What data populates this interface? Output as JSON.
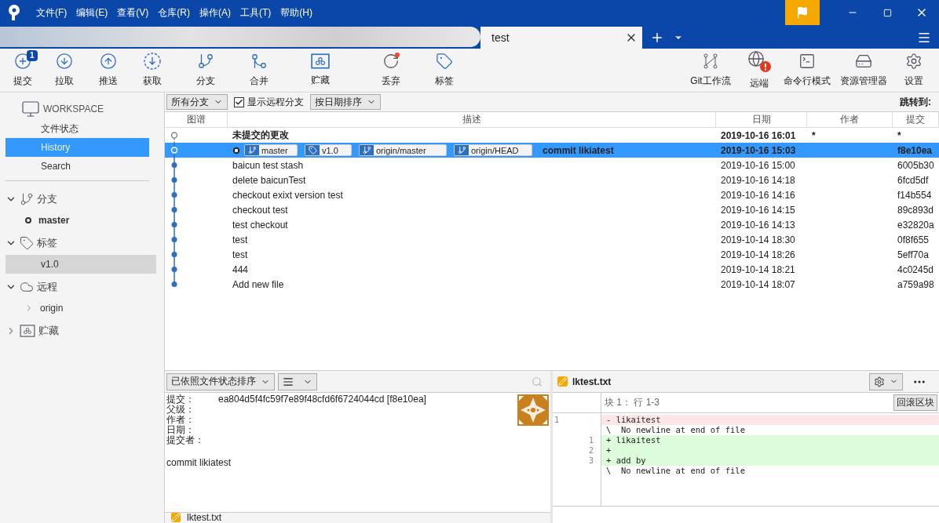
{
  "menu": [
    "文件(F)",
    "编辑(E)",
    "查看(V)",
    "仓库(R)",
    "操作(A)",
    "工具(T)",
    "帮助(H)"
  ],
  "tab": {
    "title": "test",
    "selected": true
  },
  "toolbar_left": [
    {
      "kind": "commit",
      "label": "提交",
      "badge": "1"
    },
    {
      "kind": "pull",
      "label": "拉取"
    },
    {
      "kind": "push",
      "label": "推送"
    },
    {
      "kind": "fetch",
      "label": "获取"
    },
    {
      "kind": "branch",
      "label": "分支"
    },
    {
      "kind": "merge",
      "label": "合并"
    },
    {
      "kind": "stash",
      "label": "贮藏"
    },
    {
      "kind": "discard",
      "label": "丢弃"
    },
    {
      "kind": "tag",
      "label": "标签"
    }
  ],
  "toolbar_right": [
    {
      "kind": "gitflow",
      "label": "Git工作流"
    },
    {
      "kind": "remote",
      "label": "远端"
    },
    {
      "kind": "terminal",
      "label": "命令行模式"
    },
    {
      "kind": "explorer",
      "label": "资源管理器"
    },
    {
      "kind": "settings",
      "label": "设置"
    }
  ],
  "sidebar": {
    "workspace": {
      "title": "WORKSPACE",
      "items": [
        {
          "label": "文件状态",
          "selected": false
        },
        {
          "label": "History",
          "selected": true
        },
        {
          "label": "Search",
          "selected": false
        }
      ]
    },
    "sections": [
      {
        "kind": "branch",
        "title": "分支",
        "expanded": true,
        "children": [
          {
            "label": "master",
            "current": true,
            "selected": false
          }
        ]
      },
      {
        "kind": "tag",
        "title": "标签",
        "expanded": true,
        "children": [
          {
            "label": "v1.0",
            "current": false,
            "selected": true
          }
        ]
      },
      {
        "kind": "remote",
        "title": "远程",
        "expanded": true,
        "children": [
          {
            "label": "origin",
            "current": false,
            "selected": false,
            "expanded": false
          }
        ]
      },
      {
        "kind": "stash",
        "title": "贮藏",
        "expanded": false
      }
    ]
  },
  "filter": {
    "branches": "所有分支",
    "show_remote": {
      "label": "显示远程分支",
      "checked": true
    },
    "sort": "按日期排序",
    "jump": "跳转到:"
  },
  "table": {
    "columns": [
      "图谱",
      "描述",
      "日期",
      "作者",
      "提交"
    ],
    "rows": [
      {
        "kind": "uncommitted",
        "selected": false,
        "description": "未提交的更改",
        "date": "2019-10-16 16:01",
        "author": "*",
        "commit": "*"
      },
      {
        "kind": "commit",
        "selected": true,
        "head": true,
        "refs": [
          {
            "kind": "branch",
            "label": "master"
          },
          {
            "kind": "tag",
            "label": "v1.0"
          },
          {
            "kind": "branch",
            "label": "origin/master"
          },
          {
            "kind": "branch",
            "label": "origin/HEAD"
          }
        ],
        "description": "commit likiatest",
        "date": "2019-10-16 15:03",
        "commit": "f8e10ea"
      },
      {
        "kind": "commit",
        "selected": false,
        "description": "baicun test stash",
        "date": "2019-10-16 15:00",
        "commit": "6005b30"
      },
      {
        "kind": "commit",
        "selected": false,
        "description": "delete baicunTest",
        "date": "2019-10-16 14:18",
        "commit": "6fcd5df"
      },
      {
        "kind": "commit",
        "selected": false,
        "description": "checkout exixt version test",
        "date": "2019-10-16 14:16",
        "commit": "f14b554"
      },
      {
        "kind": "commit",
        "selected": false,
        "description": "checkout test",
        "date": "2019-10-16 14:15",
        "commit": "89c893d"
      },
      {
        "kind": "commit",
        "selected": false,
        "description": "test checkout",
        "date": "2019-10-16 14:13",
        "commit": "e32820a"
      },
      {
        "kind": "commit",
        "selected": false,
        "description": "test",
        "date": "2019-10-14 18:30",
        "commit": "0f8f655"
      },
      {
        "kind": "commit",
        "selected": false,
        "description": "test",
        "date": "2019-10-14 18:26",
        "commit": "5eff70a"
      },
      {
        "kind": "commit",
        "selected": false,
        "description": "444",
        "date": "2019-10-14 18:21",
        "commit": "4c0245d"
      },
      {
        "kind": "commit",
        "selected": false,
        "description": "Add new file",
        "date": "2019-10-14 18:07",
        "commit": "a759a98"
      }
    ]
  },
  "details": {
    "sort": "已依照文件状态排序",
    "fields": [
      {
        "label": "提交：",
        "value": "ea804d5f4fc59f7e89f48cfd6f6724044cd [f8e10ea]"
      },
      {
        "label": "父级："
      },
      {
        "label": "作者："
      },
      {
        "label": "日期："
      },
      {
        "label": "提交者："
      }
    ],
    "message": "commit likiatest",
    "files": [
      {
        "name": "lktest.txt"
      }
    ]
  },
  "diff": {
    "file": "lktest.txt",
    "hunk": "块 1： 行 1-3",
    "revert": "回滚区块",
    "lines": [
      {
        "kind": "removed",
        "old": "1",
        "text": "- likaitest"
      },
      {
        "kind": "context",
        "text": "\\  No newline at end of file"
      },
      {
        "kind": "added",
        "new": "1",
        "text": "+ likaitest"
      },
      {
        "kind": "added",
        "new": "2",
        "text": "+"
      },
      {
        "kind": "added",
        "new": "3",
        "text": "+ add by"
      },
      {
        "kind": "context",
        "text": "\\  No newline at end of file"
      }
    ]
  }
}
